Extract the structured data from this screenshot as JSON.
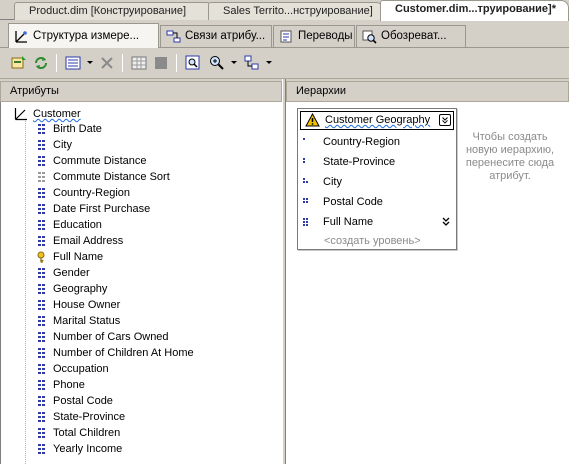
{
  "document_tabs": [
    {
      "label": "Product.dim [Конструирование]",
      "active": false
    },
    {
      "label": "Sales Territo...нструирование]",
      "active": false
    },
    {
      "label": "Customer.dim...труирование]*",
      "active": true
    }
  ],
  "designer_tabs": [
    {
      "label": "Структура измере...",
      "icon": "dimension-structure-icon",
      "active": true
    },
    {
      "label": "Связи атрибу...",
      "icon": "attribute-relationships-icon",
      "active": false
    },
    {
      "label": "Переводы",
      "icon": "translations-icon",
      "active": false
    },
    {
      "label": "Обозреват...",
      "icon": "browser-icon",
      "active": false
    }
  ],
  "attributes_panel": {
    "header": "Атрибуты",
    "root": "Customer",
    "items": [
      {
        "label": "Birth Date",
        "icon": "attribute-icon"
      },
      {
        "label": "City",
        "icon": "attribute-icon"
      },
      {
        "label": "Commute Distance",
        "icon": "attribute-icon"
      },
      {
        "label": "Commute Distance Sort",
        "icon": "attribute-disabled-icon"
      },
      {
        "label": "Country-Region",
        "icon": "attribute-icon"
      },
      {
        "label": "Date First Purchase",
        "icon": "attribute-icon"
      },
      {
        "label": "Education",
        "icon": "attribute-icon"
      },
      {
        "label": "Email Address",
        "icon": "attribute-icon"
      },
      {
        "label": "Full Name",
        "icon": "key-attribute-icon"
      },
      {
        "label": "Gender",
        "icon": "attribute-icon"
      },
      {
        "label": "Geography",
        "icon": "attribute-icon"
      },
      {
        "label": "House Owner",
        "icon": "attribute-icon"
      },
      {
        "label": "Marital Status",
        "icon": "attribute-icon"
      },
      {
        "label": "Number of Cars Owned",
        "icon": "attribute-icon"
      },
      {
        "label": "Number of Children At Home",
        "icon": "attribute-icon"
      },
      {
        "label": "Occupation",
        "icon": "attribute-icon"
      },
      {
        "label": "Phone",
        "icon": "attribute-icon"
      },
      {
        "label": "Postal Code",
        "icon": "attribute-icon"
      },
      {
        "label": "State-Province",
        "icon": "attribute-icon"
      },
      {
        "label": "Total Children",
        "icon": "attribute-icon"
      },
      {
        "label": "Yearly Income",
        "icon": "attribute-icon"
      }
    ]
  },
  "hierarchies_panel": {
    "header": "Иерархии",
    "hierarchy": {
      "name": "Customer Geography",
      "levels": [
        {
          "label": "Country-Region",
          "icon": "level-1-icon"
        },
        {
          "label": "State-Province",
          "icon": "level-2-icon"
        },
        {
          "label": "City",
          "icon": "level-3-icon"
        },
        {
          "label": "Postal Code",
          "icon": "level-4-icon"
        },
        {
          "label": "Full Name",
          "icon": "level-5-icon"
        }
      ],
      "new_level": "<создать уровень>"
    },
    "hint": "Чтобы создать новую иерархию, перенесите сюда атрибут."
  },
  "colors": {
    "chrome": "#d4d0c8",
    "attribute_icon": "#2d3aa8",
    "warning": "#f2c200",
    "squiggle": "#1e6be0"
  }
}
